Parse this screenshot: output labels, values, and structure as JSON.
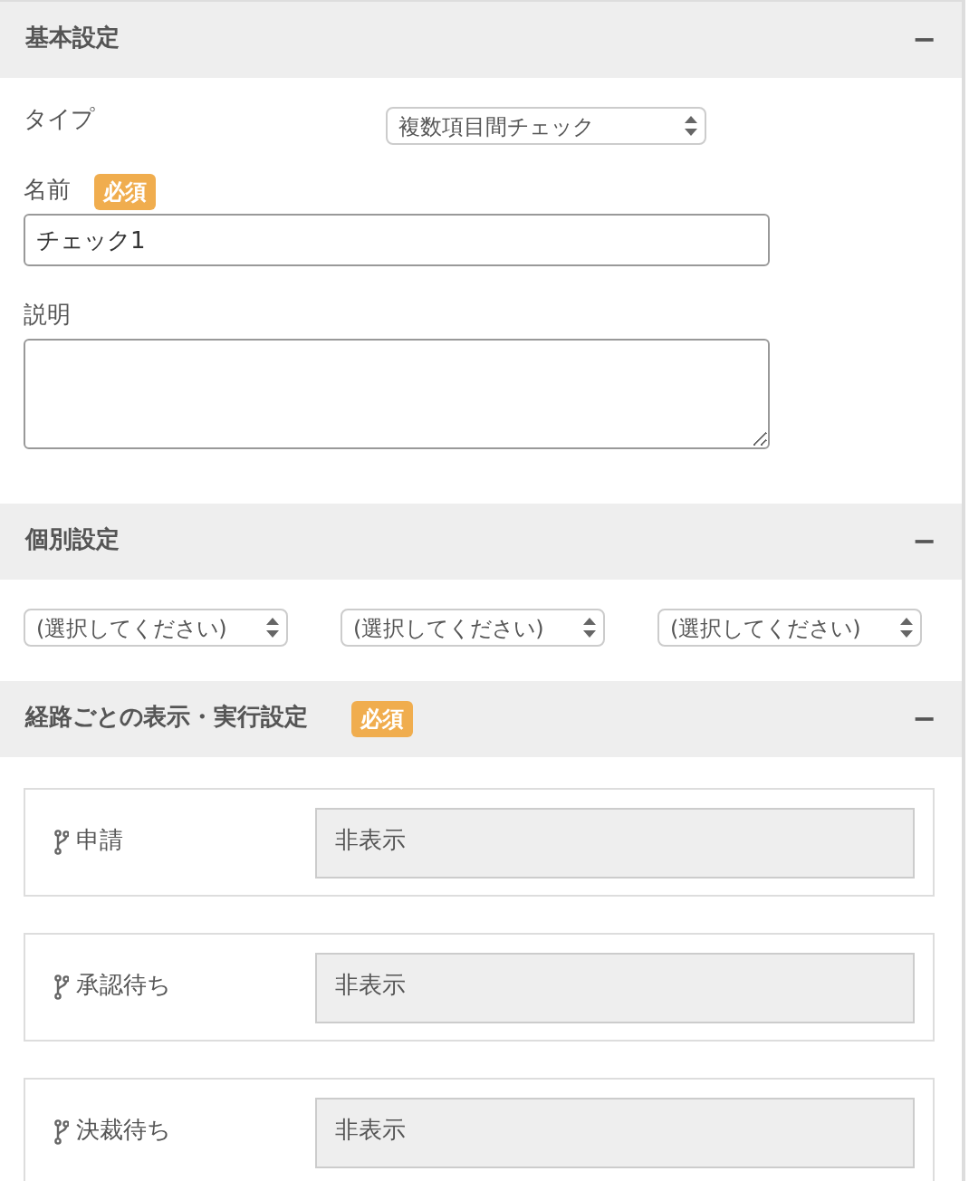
{
  "sections": [
    {
      "kind": "basic",
      "title": "基本設定",
      "toggle": "−",
      "fields": [
        {
          "kind": "select",
          "label": "タイプ",
          "value": "複数項目間チェック"
        },
        {
          "kind": "text",
          "label": "名前",
          "badge": "必須",
          "value": "チェック1"
        },
        {
          "kind": "textarea",
          "label": "説明"
        }
      ]
    },
    {
      "kind": "selects",
      "title": "個別設定",
      "toggle": "−",
      "selects": [
        {
          "value": "(選択してください)"
        },
        {
          "value": "(選択してください)"
        },
        {
          "value": "(選択してください)"
        }
      ]
    },
    {
      "kind": "routes",
      "title": "経路ごとの表示・実行設定",
      "badge": "必須",
      "toggle": "−",
      "routes": [
        {
          "label": "申請",
          "value": "非表示"
        },
        {
          "label": "承認待ち",
          "value": "非表示"
        },
        {
          "label": "決裁待ち",
          "value": "非表示"
        }
      ]
    }
  ]
}
